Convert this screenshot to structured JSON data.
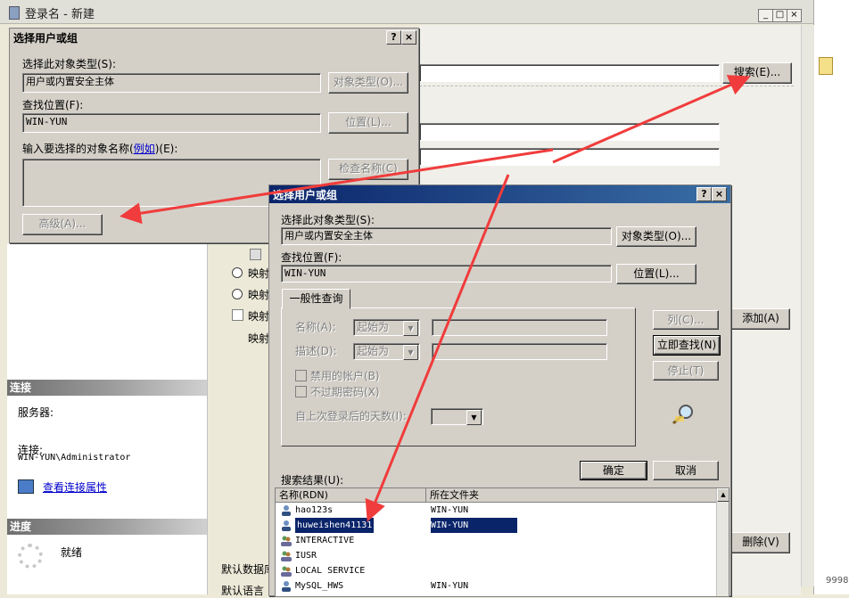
{
  "main_window": {
    "title": "登录名 - 新建",
    "min": "_",
    "max": "□",
    "close": "×"
  },
  "bg": {
    "search_button": "搜索(E)...",
    "add_button": "添加(A)",
    "remove_button": "删除(V)",
    "map_1": "映射",
    "map_2": "映射",
    "map_3": "映射",
    "map_4": "映射",
    "default_db": "默认数据库",
    "default_lang": "默认语言",
    "connection_head": "连接",
    "server_label": "服务器:",
    "connection_label": "连接:",
    "connection_value": "WIN-YUN\\Administrator",
    "view_props_link": "查看连接属性",
    "progress_head": "进度",
    "ready_text": "就绪",
    "right_edge_text": "9998"
  },
  "dialog_back": {
    "title": "选择用户或组",
    "help": "?",
    "close": "×",
    "object_type_label": "选择此对象类型(S):",
    "object_type_value": "用户或内置安全主体",
    "object_type_button": "对象类型(O)...",
    "location_label": "查找位置(F):",
    "location_value": "WIN-YUN",
    "location_button": "位置(L)...",
    "enter_names_label_pre": "输入要选择的对象名称(",
    "enter_names_link": "例如",
    "enter_names_label_post": ")(E):",
    "check_names_button": "检查名称(C)",
    "advanced_button": "高级(A)..."
  },
  "dialog_front": {
    "title": "选择用户或组",
    "help": "?",
    "close": "×",
    "object_type_label": "选择此对象类型(S):",
    "object_type_value": "用户或内置安全主体",
    "object_type_button": "对象类型(O)...",
    "location_label": "查找位置(F):",
    "location_value": "WIN-YUN",
    "location_button": "位置(L)...",
    "tab_general": "一般性查询",
    "name_label": "名称(A):",
    "name_combo": "起始为",
    "desc_label": "描述(D):",
    "desc_combo": "起始为",
    "disabled_accounts": "禁用的帐户(B)",
    "non_expiring": "不过期密码(X)",
    "days_since_login": "自上次登录后的天数(I):",
    "columns_button": "列(C)...",
    "find_now_button": "立即查找(N)",
    "stop_button": "停止(T)",
    "ok_button": "确定",
    "cancel_button": "取消",
    "results_label": "搜索结果(U):",
    "col_name": "名称(RDN)",
    "col_folder": "所在文件夹",
    "rows": [
      {
        "name": "hao123s",
        "folder": "WIN-YUN",
        "icon": "user-icon"
      },
      {
        "name": "huweishen41131",
        "folder": "WIN-YUN",
        "icon": "user-icon",
        "selected": true
      },
      {
        "name": "INTERACTIVE",
        "folder": "",
        "icon": "group-icon"
      },
      {
        "name": "IUSR",
        "folder": "",
        "icon": "group-icon"
      },
      {
        "name": "LOCAL SERVICE",
        "folder": "",
        "icon": "group-icon"
      },
      {
        "name": "MySQL_HWS",
        "folder": "WIN-YUN",
        "icon": "user-icon"
      }
    ]
  },
  "colors": {
    "title_blue": "#0a246a",
    "annotation_red": "#f03c3c"
  }
}
